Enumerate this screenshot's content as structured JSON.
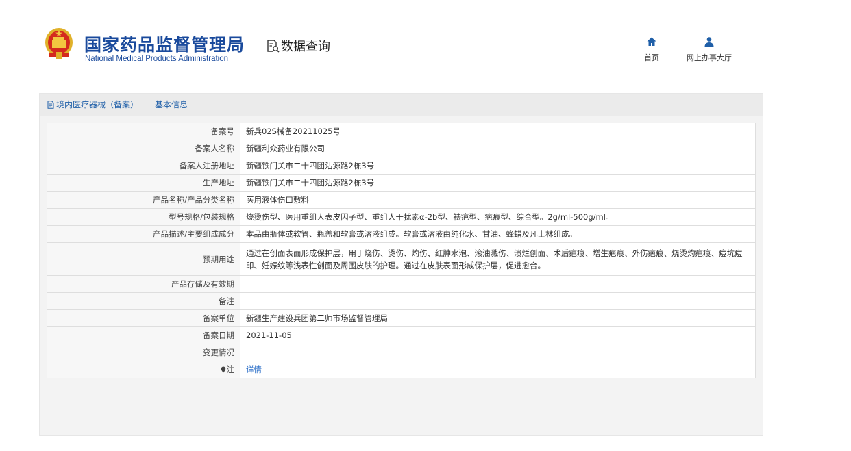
{
  "header": {
    "brand_cn": "国家药品监督管理局",
    "brand_en": "National Medical Products Administration",
    "query_label": "数据查询",
    "nav": [
      {
        "label": "首页",
        "icon": "home-icon"
      },
      {
        "label": "网上办事大厅",
        "icon": "user-icon"
      }
    ]
  },
  "panel": {
    "title": "境内医疗器械（备案）——基本信息",
    "rows": [
      {
        "label": "备案号",
        "value": "新兵02S械备20211025号"
      },
      {
        "label": "备案人名称",
        "value": "新疆利众药业有限公司"
      },
      {
        "label": "备案人注册地址",
        "value": "新疆铁门关市二十四团沽源路2栋3号"
      },
      {
        "label": "生产地址",
        "value": "新疆铁门关市二十四团沽源路2栋3号"
      },
      {
        "label": "产品名称/产品分类名称",
        "value": "医用液体伤口敷料"
      },
      {
        "label": "型号规格/包装规格",
        "value": "烧烫伤型、医用重组人表皮因子型、重组人干扰素α-2b型、祛疤型、疤痕型、综合型。2g/ml-500g/ml。"
      },
      {
        "label": "产品描述/主要组成成分",
        "value": "本品由瓶体或软管、瓶盖和软膏或溶液组成。软膏或溶液由纯化水、甘油、蜂蜡及凡士林组成。"
      },
      {
        "label": "预期用途",
        "value": "通过在创面表面形成保护层，用于烧伤、烫伤、灼伤、红肿水泡、滚油溅伤、溃烂创面、术后疤痕、增生疤痕、外伤疤痕、烧烫灼疤痕、痘坑痘印、妊娠纹等浅表性创面及周围皮肤的护理。通过在皮肤表面形成保护层，促进愈合。"
      },
      {
        "label": "产品存储及有效期",
        "value": ""
      },
      {
        "label": "备注",
        "value": ""
      },
      {
        "label": "备案单位",
        "value": "新疆生产建设兵团第二师市场监督管理局"
      },
      {
        "label": "备案日期",
        "value": "2021-11-05"
      },
      {
        "label": "变更情况",
        "value": ""
      }
    ],
    "note_label": "注",
    "note_link": "详情"
  },
  "colors": {
    "brand_blue": "#1a4a9c",
    "link_blue": "#2a6ec8",
    "header_rule": "#7aa7d6"
  }
}
